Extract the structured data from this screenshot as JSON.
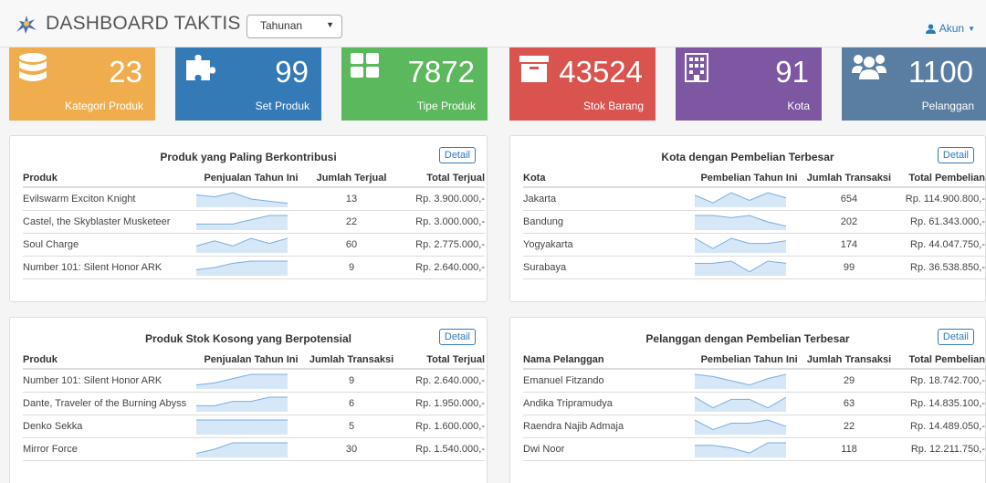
{
  "header": {
    "title": "DASHBOARD TAKTIS",
    "period_select": "Tahunan",
    "account_label": "Akun"
  },
  "tiles": [
    {
      "value": "23",
      "label": "Kategori Produk",
      "color": "#f0ad4e",
      "icon": "database-icon"
    },
    {
      "value": "99",
      "label": "Set Produk",
      "color": "#337ab7",
      "icon": "puzzle-icon"
    },
    {
      "value": "7872",
      "label": "Tipe Produk",
      "color": "#5cb85c",
      "icon": "grid-icon"
    },
    {
      "value": "43524",
      "label": "Stok Barang",
      "color": "#d9534f",
      "icon": "archive-icon"
    },
    {
      "value": "91",
      "label": "Kota",
      "color": "#7e57a3",
      "icon": "building-icon"
    },
    {
      "value": "1100",
      "label": "Pelanggan",
      "color": "#5a7ea2",
      "icon": "users-icon"
    }
  ],
  "panels": {
    "top_products": {
      "title": "Produk yang Paling Berkontribusi",
      "detail": "Detail",
      "headers": [
        "Produk",
        "Penjualan Tahun Ini",
        "Jumlah Terjual",
        "Total Terjual"
      ],
      "rows": [
        {
          "name": "Evilswarm Exciton Knight",
          "qty": "13",
          "total": "Rp. 3.900.000,-",
          "spark": [
            5,
            4,
            6,
            3,
            2,
            1
          ]
        },
        {
          "name": "Castel, the Skyblaster Musketeer",
          "qty": "22",
          "total": "Rp. 3.000.000,-",
          "spark": [
            2,
            2,
            2,
            4,
            6,
            6
          ]
        },
        {
          "name": "Soul Charge",
          "qty": "60",
          "total": "Rp. 2.775.000,-",
          "spark": [
            2,
            4,
            2,
            5,
            3,
            5
          ]
        },
        {
          "name": "Number 101: Silent Honor ARK",
          "qty": "9",
          "total": "Rp. 2.640.000,-",
          "spark": [
            2,
            3,
            5,
            6,
            6,
            6
          ]
        }
      ]
    },
    "top_cities": {
      "title": "Kota dengan Pembelian Terbesar",
      "detail": "Detail",
      "headers": [
        "Kota",
        "Pembelian Tahun Ini",
        "Jumlah Transaksi",
        "Total Pembelian"
      ],
      "rows": [
        {
          "name": "Jakarta",
          "qty": "654",
          "total": "Rp. 114.900.800,-",
          "spark": [
            4,
            1,
            5,
            2,
            5,
            3
          ]
        },
        {
          "name": "Bandung",
          "qty": "202",
          "total": "Rp. 61.343.000,-",
          "spark": [
            6,
            6,
            5,
            6,
            3,
            1
          ]
        },
        {
          "name": "Yogyakarta",
          "qty": "174",
          "total": "Rp. 44.047.750,-",
          "spark": [
            5,
            1,
            5,
            3,
            3,
            4
          ]
        },
        {
          "name": "Surabaya",
          "qty": "99",
          "total": "Rp. 36.538.850,-",
          "spark": [
            5,
            5,
            6,
            1,
            6,
            5
          ]
        }
      ]
    },
    "zero_stock": {
      "title": "Produk Stok Kosong yang Berpotensial",
      "detail": "Detail",
      "headers": [
        "Produk",
        "Penjualan Tahun Ini",
        "Jumlah Transaksi",
        "Total Terjual"
      ],
      "rows": [
        {
          "name": "Number 101: Silent Honor ARK",
          "qty": "9",
          "total": "Rp. 2.640.000,-",
          "spark": [
            1,
            2,
            4,
            6,
            6,
            6
          ]
        },
        {
          "name": "Dante, Traveler of the Burning Abyss",
          "qty": "6",
          "total": "Rp. 1.950.000,-",
          "spark": [
            1,
            1,
            2,
            2,
            3,
            3
          ]
        },
        {
          "name": "Denko Sekka",
          "qty": "5",
          "total": "Rp. 1.600.000,-",
          "spark": [
            1,
            1,
            1,
            1,
            1,
            1
          ]
        },
        {
          "name": "Mirror Force",
          "qty": "30",
          "total": "Rp. 1.540.000,-",
          "spark": [
            1,
            3,
            6,
            6,
            6,
            6
          ]
        }
      ]
    },
    "top_customers": {
      "title": "Pelanggan dengan Pembelian Terbesar",
      "detail": "Detail",
      "headers": [
        "Nama Pelanggan",
        "Pembelian Tahun Ini",
        "Jumlah Transaksi",
        "Total Pembelian"
      ],
      "rows": [
        {
          "name": "Emanuel Fitzando",
          "qty": "29",
          "total": "Rp. 18.742.700,-",
          "spark": [
            6,
            5,
            3,
            1,
            4,
            6
          ]
        },
        {
          "name": "Andika Tripramudya",
          "qty": "63",
          "total": "Rp. 14.835.100,-",
          "spark": [
            6,
            1,
            5,
            5,
            1,
            6
          ]
        },
        {
          "name": "Raendra Najib Admaja",
          "qty": "22",
          "total": "Rp. 14.489.050,-",
          "spark": [
            4,
            1,
            3,
            3,
            4,
            2
          ]
        },
        {
          "name": "Dwi Noor",
          "qty": "118",
          "total": "Rp. 12.211.750,-",
          "spark": [
            4,
            4,
            3,
            1,
            5,
            5
          ]
        }
      ]
    }
  }
}
